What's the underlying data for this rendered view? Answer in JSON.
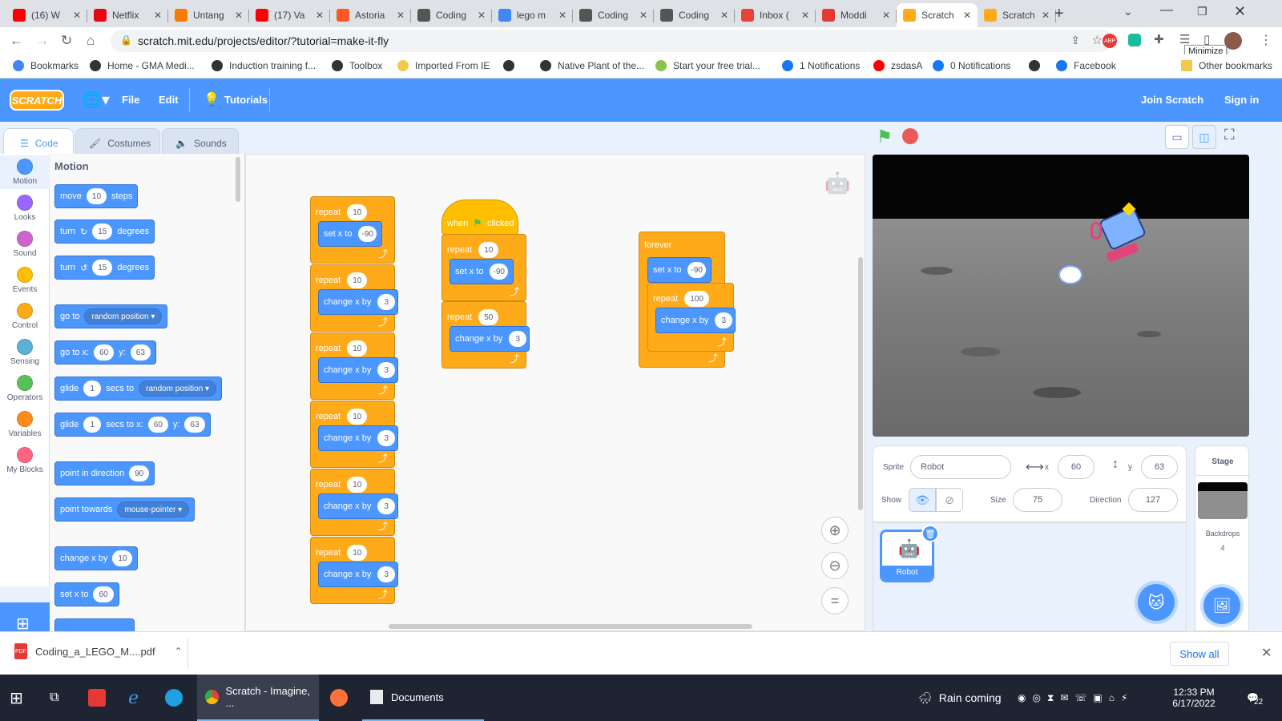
{
  "browser": {
    "tabs": [
      {
        "title": "(16) W",
        "icon": "youtube-icon",
        "color": "#ff0000"
      },
      {
        "title": "Netflix",
        "icon": "netflix-icon",
        "color": "#e50914"
      },
      {
        "title": "Untang",
        "icon": "untangle-icon",
        "color": "#f57c00"
      },
      {
        "title": "(17) Va",
        "icon": "youtube-icon",
        "color": "#ff0000"
      },
      {
        "title": "Astoria",
        "icon": "astoria-icon",
        "color": "#ff5722"
      },
      {
        "title": "Coding",
        "icon": "sheets-icon",
        "color": "#555555"
      },
      {
        "title": "lego m",
        "icon": "google-icon",
        "color": "#4285f4"
      },
      {
        "title": "Coding",
        "icon": "sheets-icon",
        "color": "#555555"
      },
      {
        "title": "Coding",
        "icon": "sheets-icon",
        "color": "#555555"
      },
      {
        "title": "Inbox (",
        "icon": "gmail-icon",
        "color": "#ea4335"
      },
      {
        "title": "Moddi",
        "icon": "tinkercad-icon",
        "color": "#e53935"
      },
      {
        "title": "Scratch",
        "icon": "scratch-icon",
        "color": "#ffab19",
        "active": true
      },
      {
        "title": "Scratch",
        "icon": "scratch-icon",
        "color": "#ffab19"
      }
    ],
    "url": "scratch.mit.edu/projects/editor/?tutorial=make-it-fly",
    "tooltip": "Minimize",
    "bookmarks": [
      {
        "label": "Bookmarks",
        "color": "#4285f4"
      },
      {
        "label": "Home - GMA Medi...",
        "color": "#333333"
      },
      {
        "label": "Induction training f...",
        "color": "#333333"
      },
      {
        "label": "Toolbox",
        "color": "#333333"
      },
      {
        "label": "Imported From IE",
        "color": "#f2c94c"
      },
      {
        "label": "",
        "color": "#333333"
      },
      {
        "label": "Native Plant of the...",
        "color": "#333333"
      },
      {
        "label": "Start your free trial...",
        "color": "#8bc34a"
      },
      {
        "label": "1 Notifications",
        "color": "#1877f2"
      },
      {
        "label": "zsdasA",
        "color": "#ff0000"
      },
      {
        "label": "0 Notifications",
        "color": "#1877f2"
      },
      {
        "label": "",
        "color": "#333333"
      },
      {
        "label": "Facebook",
        "color": "#1877f2"
      }
    ],
    "other_bookmarks": "Other bookmarks"
  },
  "scratch": {
    "logo": "SCRATCH",
    "menu": {
      "file": "File",
      "edit": "Edit",
      "tutorials": "Tutorials",
      "join": "Join Scratch",
      "signin": "Sign in"
    },
    "editor_tabs": {
      "code": "Code",
      "costumes": "Costumes",
      "sounds": "Sounds"
    },
    "categories": [
      {
        "label": "Motion",
        "color": "#4c97ff"
      },
      {
        "label": "Looks",
        "color": "#9966ff"
      },
      {
        "label": "Sound",
        "color": "#cf63cf"
      },
      {
        "label": "Events",
        "color": "#ffbf00"
      },
      {
        "label": "Control",
        "color": "#ffab19"
      },
      {
        "label": "Sensing",
        "color": "#5cb1d6"
      },
      {
        "label": "Operators",
        "color": "#59c059"
      },
      {
        "label": "Variables",
        "color": "#ff8c1a"
      },
      {
        "label": "My Blocks",
        "color": "#ff6680"
      }
    ],
    "palette": {
      "heading": "Motion",
      "move": {
        "a": "move",
        "n": "10",
        "b": "steps"
      },
      "turn_right": {
        "a": "turn",
        "n": "15",
        "b": "degrees"
      },
      "turn_left": {
        "a": "turn",
        "n": "15",
        "b": "degrees"
      },
      "goto": {
        "a": "go to",
        "dd": "random position"
      },
      "gotoxy": {
        "a": "go to x:",
        "x": "60",
        "b": "y:",
        "y": "63"
      },
      "glide": {
        "a": "glide",
        "n": "1",
        "b": "secs to",
        "dd": "random position"
      },
      "glidexy": {
        "a": "glide",
        "n": "1",
        "b": "secs to x:",
        "x": "60",
        "c": "y:",
        "y": "63"
      },
      "point": {
        "a": "point in direction",
        "n": "90"
      },
      "towards": {
        "a": "point towards",
        "dd": "mouse-pointer"
      },
      "changex": {
        "a": "change x by",
        "n": "10"
      },
      "setx": {
        "a": "set x to",
        "n": "60"
      }
    },
    "script1": {
      "repeats": [
        {
          "label": "repeat",
          "n": "10",
          "inner": "set x to",
          "v": "-90"
        },
        {
          "label": "repeat",
          "n": "10",
          "inner": "change x by",
          "v": "3"
        },
        {
          "label": "repeat",
          "n": "10",
          "inner": "change x by",
          "v": "3"
        },
        {
          "label": "repeat",
          "n": "10",
          "inner": "change x by",
          "v": "3"
        },
        {
          "label": "repeat",
          "n": "10",
          "inner": "change x by",
          "v": "3"
        },
        {
          "label": "repeat",
          "n": "10",
          "inner": "change x by",
          "v": "3"
        }
      ]
    },
    "script2": {
      "hat_a": "when",
      "hat_b": "clicked",
      "r1": {
        "label": "repeat",
        "n": "10",
        "inner": "set x to",
        "v": "-90"
      },
      "r2": {
        "label": "repeat",
        "n": "50",
        "inner": "change x by",
        "v": "3"
      }
    },
    "script3": {
      "forever": "forever",
      "setx": {
        "label": "set x to",
        "v": "-90"
      },
      "r": {
        "label": "repeat",
        "n": "100",
        "inner": "change x by",
        "v": "3"
      }
    },
    "sprite": {
      "sprite_label": "Sprite",
      "name": "Robot",
      "x_label": "x",
      "x": "60",
      "y_label": "y",
      "y": "63",
      "show_label": "Show",
      "size_label": "Size",
      "size": "75",
      "direction_label": "Direction",
      "direction": "127",
      "thumb_name": "Robot"
    },
    "stage": {
      "label": "Stage",
      "backdrops_label": "Backdrops",
      "backdrops": "4"
    }
  },
  "download": {
    "file": "Coding_a_LEGO_M....pdf",
    "show_all": "Show all"
  },
  "taskbar": {
    "scratch_window": "Scratch - Imagine, ...",
    "documents": "Documents",
    "weather": "Rain coming",
    "time": "12:33 PM",
    "date": "6/17/2022",
    "notifications": "22"
  }
}
